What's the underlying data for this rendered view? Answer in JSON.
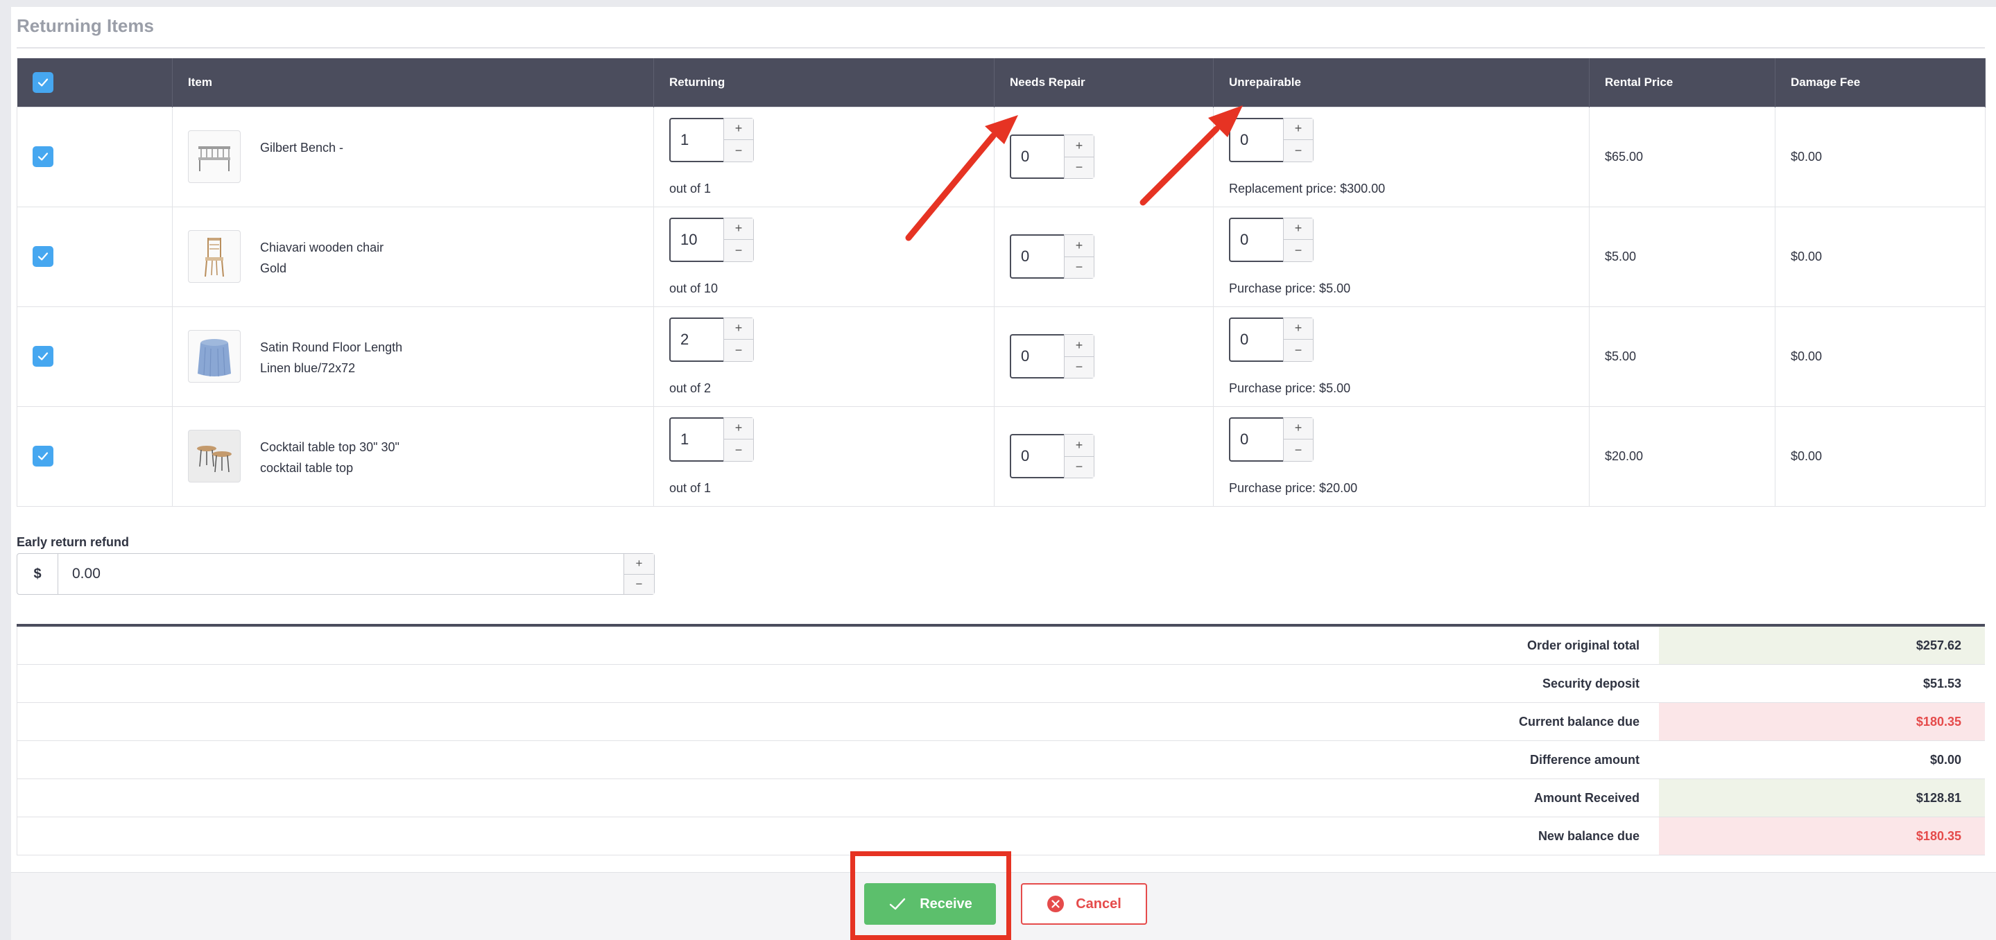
{
  "section_title": "Returning Items",
  "table": {
    "headers": {
      "item": "Item",
      "returning": "Returning",
      "needs_repair": "Needs Repair",
      "unrepairable": "Unrepairable",
      "rental_price": "Rental Price",
      "damage_fee": "Damage Fee"
    },
    "rows": [
      {
        "name_line1": "Gilbert Bench -",
        "name_line2": "",
        "returning": "1",
        "out_of": "out of 1",
        "needs_repair": "0",
        "unrepairable": "0",
        "price_note": "Replacement price: $300.00",
        "rental_price": "$65.00",
        "damage_fee": "$0.00"
      },
      {
        "name_line1": "Chiavari wooden chair",
        "name_line2": "Gold",
        "returning": "10",
        "out_of": "out of 10",
        "needs_repair": "0",
        "unrepairable": "0",
        "price_note": "Purchase price: $5.00",
        "rental_price": "$5.00",
        "damage_fee": "$0.00"
      },
      {
        "name_line1": "Satin Round Floor Length",
        "name_line2": "Linen blue/72x72",
        "returning": "2",
        "out_of": "out of 2",
        "needs_repair": "0",
        "unrepairable": "0",
        "price_note": "Purchase price: $5.00",
        "rental_price": "$5.00",
        "damage_fee": "$0.00"
      },
      {
        "name_line1": "Cocktail table top 30\" 30\"",
        "name_line2": "cocktail table top",
        "returning": "1",
        "out_of": "out of 1",
        "needs_repair": "0",
        "unrepairable": "0",
        "price_note": "Purchase price: $20.00",
        "rental_price": "$20.00",
        "damage_fee": "$0.00"
      }
    ]
  },
  "stepper": {
    "plus": "+",
    "minus": "−"
  },
  "early_return": {
    "label": "Early return refund",
    "prefix": "$",
    "value": "0.00"
  },
  "summary": {
    "order_original_total": {
      "label": "Order original total",
      "value": "$257.62"
    },
    "security_deposit": {
      "label": "Security deposit",
      "value": "$51.53"
    },
    "current_balance_due": {
      "label": "Current balance due",
      "value": "$180.35"
    },
    "difference_amount": {
      "label": "Difference amount",
      "value": "$0.00"
    },
    "amount_received": {
      "label": "Amount Received",
      "value": "$128.81"
    },
    "new_balance_due": {
      "label": "New balance due",
      "value": "$180.35"
    }
  },
  "actions": {
    "receive_label": "Receive",
    "cancel_label": "Cancel"
  },
  "colors": {
    "header_bg": "#4b4d5d",
    "checkbox": "#46a7f0",
    "receive": "#5cbf6c",
    "cancel": "#e54b4b",
    "annotation": "#e63323"
  },
  "icons": {
    "checkbox": "checkmark-icon",
    "receive": "check-icon",
    "cancel": "circle-x-icon"
  }
}
